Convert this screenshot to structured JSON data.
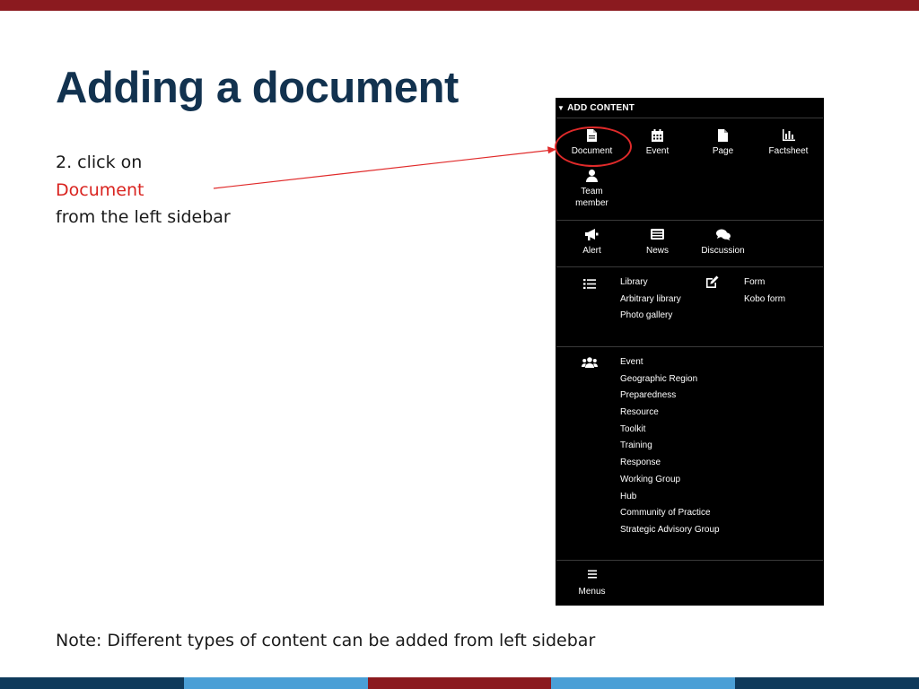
{
  "slide": {
    "title": "Adding a document",
    "instruction_line1": "2. click on",
    "instruction_highlight": "Document",
    "instruction_line3": "from the left sidebar",
    "note": "Note: Different types of content can be added from left sidebar"
  },
  "panel": {
    "header": "ADD CONTENT",
    "top_tiles": [
      {
        "label": "Document",
        "icon": "document-icon"
      },
      {
        "label": "Event",
        "icon": "calendar-icon"
      },
      {
        "label": "Page",
        "icon": "page-icon"
      },
      {
        "label": "Factsheet",
        "icon": "bar-chart-icon"
      }
    ],
    "team_tile": {
      "label_line1": "Team",
      "label_line2": "member",
      "icon": "person-icon"
    },
    "mid_tiles": [
      {
        "label": "Alert",
        "icon": "megaphone-icon"
      },
      {
        "label": "News",
        "icon": "newspaper-icon"
      },
      {
        "label": "Discussion",
        "icon": "comments-icon"
      }
    ],
    "library_items": [
      "Library",
      "Arbitrary library",
      "Photo gallery"
    ],
    "form_items": [
      "Form",
      "Kobo form"
    ],
    "group_items": [
      "Event",
      "Geographic Region",
      "Preparedness",
      "Resource",
      "Toolkit",
      "Training",
      "Response",
      "Working Group",
      "Hub",
      "Community of Practice",
      "Strategic Advisory Group"
    ],
    "menus_label": "Menus"
  },
  "colors": {
    "title": "#12324f",
    "highlight": "#d9231f",
    "top_bar": "#8b1a1f",
    "panel_bg": "#000000"
  }
}
